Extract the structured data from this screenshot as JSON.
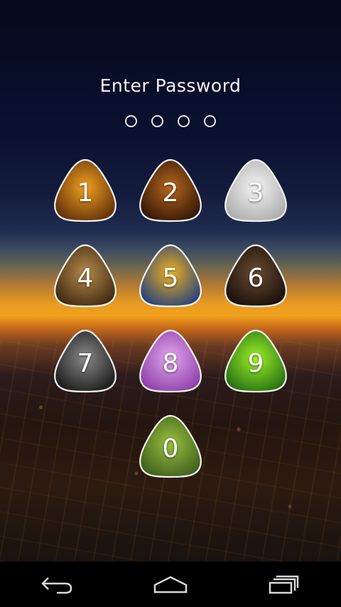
{
  "header": {
    "title": "Enter Password"
  },
  "pin": {
    "length": 4,
    "entered": 0
  },
  "keypad": {
    "keys": [
      {
        "label": "1",
        "image": "tiger-photo",
        "c1": "#f0a020",
        "c2": "#5a2a08"
      },
      {
        "label": "2",
        "image": "lion-photo",
        "c1": "#b8671c",
        "c2": "#2a1206"
      },
      {
        "label": "3",
        "image": "white-cat-photo",
        "c1": "#f4f4f4",
        "c2": "#a9a9a9"
      },
      {
        "label": "4",
        "image": "snake-photo",
        "c1": "#b48a4a",
        "c2": "#3a2410"
      },
      {
        "label": "5",
        "image": "blue-bird-photo",
        "c1": "#f0b020",
        "c2": "#1a3c80"
      },
      {
        "label": "6",
        "image": "fish-photo",
        "c1": "#6a4a30",
        "c2": "#150c08"
      },
      {
        "label": "7",
        "image": "gorilla-photo",
        "c1": "#8a8a8a",
        "c2": "#151515"
      },
      {
        "label": "8",
        "image": "flower-photo",
        "c1": "#e2a6ee",
        "c2": "#8a3aa4"
      },
      {
        "label": "9",
        "image": "lizard-eye-photo",
        "c1": "#9ef02a",
        "c2": "#1e6a10"
      },
      {
        "label": "0",
        "image": "bee-eater-photo",
        "c1": "#9ac040",
        "c2": "#3a5a1a"
      }
    ]
  },
  "navbar": {
    "buttons": [
      "back",
      "home",
      "recent-apps"
    ]
  }
}
